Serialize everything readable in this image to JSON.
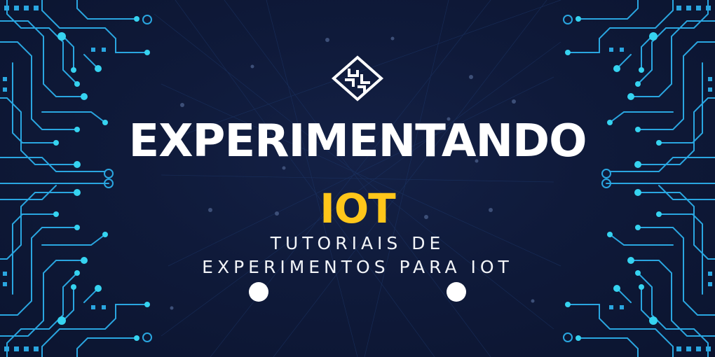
{
  "banner": {
    "title": "EXPERIMENTANDO",
    "highlight": "IOT",
    "subtitle_line1": "TUTORIAIS DE",
    "subtitle_line2": "EXPERIMENTOS PARA IOT"
  },
  "colors": {
    "background": "#0d1631",
    "title": "#ffffff",
    "highlight": "#ffc61a",
    "circuit": "#2aa6e0",
    "circuit_node": "#36d3f0"
  },
  "icons": {
    "logo": "circuit-diamond-logo",
    "decorations": [
      "circuit-board-left",
      "circuit-board-right",
      "white-dot"
    ]
  }
}
